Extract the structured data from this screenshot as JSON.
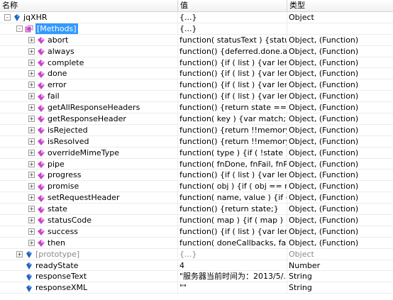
{
  "header": {
    "name": "名称",
    "value": "值",
    "type": "类型"
  },
  "rows": [
    {
      "name": "jqXHR",
      "value": "{...}",
      "type": "Object",
      "depth": 0,
      "expand": "-",
      "icon": "blue"
    },
    {
      "name": "[Methods]",
      "value": "{...}",
      "type": "",
      "depth": 1,
      "expand": "-",
      "icon": "magenta-cube",
      "selected": true
    },
    {
      "name": "abort",
      "value": "function( statusText ) {status...",
      "type": "Object, (Function)",
      "depth": 2,
      "expand": "+",
      "icon": "magenta"
    },
    {
      "name": "always",
      "value": "function() {deferred.done.ap...",
      "type": "Object, (Function)",
      "depth": 2,
      "expand": "+",
      "icon": "magenta"
    },
    {
      "name": "complete",
      "value": "function() {if ( list ) {var lengt...",
      "type": "Object, (Function)",
      "depth": 2,
      "expand": "+",
      "icon": "magenta"
    },
    {
      "name": "done",
      "value": "function() {if ( list ) {var lengt...",
      "type": "Object, (Function)",
      "depth": 2,
      "expand": "+",
      "icon": "magenta"
    },
    {
      "name": "error",
      "value": "function() {if ( list ) {var lengt...",
      "type": "Object, (Function)",
      "depth": 2,
      "expand": "+",
      "icon": "magenta"
    },
    {
      "name": "fail",
      "value": "function() {if ( list ) {var lengt...",
      "type": "Object, (Function)",
      "depth": 2,
      "expand": "+",
      "icon": "magenta"
    },
    {
      "name": "getAllResponseHeaders",
      "value": "function() {return state === ...",
      "type": "Object, (Function)",
      "depth": 2,
      "expand": "+",
      "icon": "magenta"
    },
    {
      "name": "getResponseHeader",
      "value": "function( key ) {var match;if ...",
      "type": "Object, (Function)",
      "depth": 2,
      "expand": "+",
      "icon": "magenta"
    },
    {
      "name": "isRejected",
      "value": "function() {return !!memory;}",
      "type": "Object, (Function)",
      "depth": 2,
      "expand": "+",
      "icon": "magenta"
    },
    {
      "name": "isResolved",
      "value": "function() {return !!memory;}",
      "type": "Object, (Function)",
      "depth": 2,
      "expand": "+",
      "icon": "magenta"
    },
    {
      "name": "overrideMimeType",
      "value": "function( type ) {if ( !state ) {...",
      "type": "Object, (Function)",
      "depth": 2,
      "expand": "+",
      "icon": "magenta"
    },
    {
      "name": "pipe",
      "value": "function( fnDone, fnFail, fnPr...",
      "type": "Object, (Function)",
      "depth": 2,
      "expand": "+",
      "icon": "magenta"
    },
    {
      "name": "progress",
      "value": "function() {if ( list ) {var lengt...",
      "type": "Object, (Function)",
      "depth": 2,
      "expand": "+",
      "icon": "magenta"
    },
    {
      "name": "promise",
      "value": "function( obj ) {if ( obj == n...",
      "type": "Object, (Function)",
      "depth": 2,
      "expand": "+",
      "icon": "magenta"
    },
    {
      "name": "setRequestHeader",
      "value": "function( name, value ) {if ( !...",
      "type": "Object, (Function)",
      "depth": 2,
      "expand": "+",
      "icon": "magenta"
    },
    {
      "name": "state",
      "value": "function() {return state;}",
      "type": "Object, (Function)",
      "depth": 2,
      "expand": "+",
      "icon": "magenta"
    },
    {
      "name": "statusCode",
      "value": "function( map ) {if ( map ) {v...",
      "type": "Object, (Function)",
      "depth": 2,
      "expand": "+",
      "icon": "magenta"
    },
    {
      "name": "success",
      "value": "function() {if ( list ) {var lengt...",
      "type": "Object, (Function)",
      "depth": 2,
      "expand": "+",
      "icon": "magenta"
    },
    {
      "name": "then",
      "value": "function( doneCallbacks, fail...",
      "type": "Object, (Function)",
      "depth": 2,
      "expand": "+",
      "icon": "magenta"
    },
    {
      "name": "[prototype]",
      "value": "{...}",
      "type": "Object",
      "depth": 1,
      "expand": "+",
      "icon": "blue",
      "gray": true
    },
    {
      "name": "readyState",
      "value": "4",
      "type": "Number",
      "depth": 1,
      "expand": "",
      "icon": "blue"
    },
    {
      "name": "responseText",
      "value": "\"服务器当前时间为：2013/5/...",
      "type": "String",
      "depth": 1,
      "expand": "",
      "icon": "blue"
    },
    {
      "name": "responseXML",
      "value": "\"\"",
      "type": "String",
      "depth": 1,
      "expand": "",
      "icon": "blue"
    }
  ],
  "colors": {
    "blue": "#1f62c4",
    "magenta": "#c845c8",
    "selection": "#3399ff"
  }
}
